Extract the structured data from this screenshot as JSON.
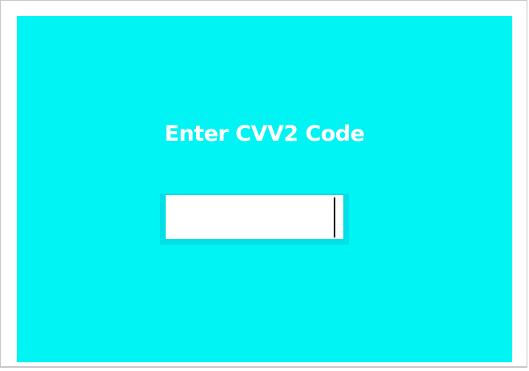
{
  "dialog": {
    "title": "Enter CVV2 Code",
    "cvv_input": {
      "value": "",
      "placeholder": ""
    }
  },
  "colors": {
    "panel_background": "#00f4f4",
    "title_text": "#ffffff",
    "input_background": "#ffffff"
  }
}
